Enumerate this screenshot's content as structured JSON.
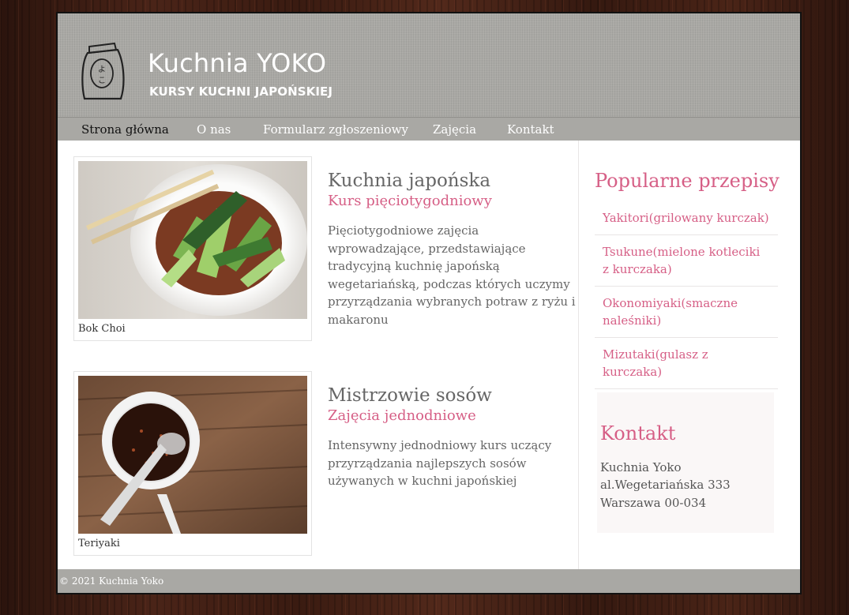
{
  "header": {
    "title": "Kuchnia YOKO",
    "subtitle": "KURSY KUCHNI JAPOŃSKIEJ",
    "logo_glyphs": "よこ",
    "logo_icon": "rice-bag-logo-icon"
  },
  "nav": {
    "items": [
      {
        "label": "Strona główna",
        "active": true
      },
      {
        "label": "O nas",
        "active": false
      },
      {
        "label": "Formularz zgłoszeniowy",
        "active": false
      },
      {
        "label": "Zajęcia",
        "active": false
      },
      {
        "label": "Kontakt",
        "active": false
      }
    ]
  },
  "courses": [
    {
      "image_caption": "Bok Choi",
      "title": "Kuchnia japońska",
      "subtitle": "Kurs pięciotygodniowy",
      "description": "Pięciotygodniowe zajęcia wprowadzające, przedstawiające tradycyjną kuchnię japońską wegetariańską, podczas których uczymy przyrządzania wybranych potraw z ryżu i makaronu"
    },
    {
      "image_caption": "Teriyaki",
      "title": "Mistrzowie sosów",
      "subtitle": "Zajęcia jednodniowe",
      "description": "Intensywny jednodniowy kurs uczący przyrządzania najlepszych sosów używanych w kuchni japońskiej"
    }
  ],
  "sidebar": {
    "popular_title": "Popularne przepisy",
    "recipes": [
      "Yakitori(grilowany kurczak)",
      "Tsukune(mielone kotleciki z kurczaka)",
      "Okonomiyaki(smaczne naleśniki)",
      "Mizutaki(gulasz z kurczaka)"
    ],
    "contact_title": "Kontakt",
    "contact_lines": [
      "Kuchnia Yoko",
      "al.Wegetariańska 333",
      "Warszawa 00-034"
    ]
  },
  "footer": {
    "copyright": "© 2021 Kuchnia Yoko"
  },
  "colors": {
    "accent_pink": "#d65f86",
    "header_gray": "#a9a8a4",
    "text_gray": "#666666"
  }
}
